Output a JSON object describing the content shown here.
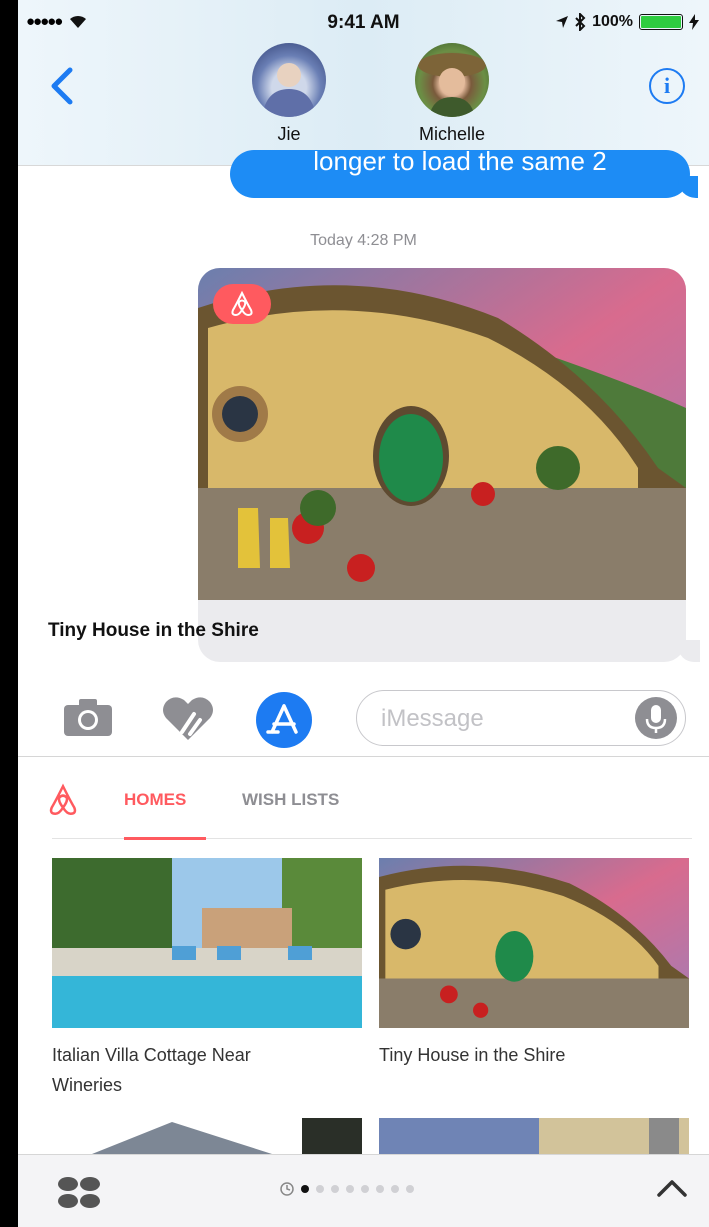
{
  "status_bar": {
    "signal": "●●●●●",
    "time": "9:41 AM",
    "battery_pct": "100%"
  },
  "header": {
    "contacts": [
      {
        "name": "Jie"
      },
      {
        "name": "Michelle"
      }
    ],
    "info_glyph": "i"
  },
  "conversation": {
    "previous_message_fragment": "longer to load the same 2",
    "timestamp": "Today 4:28 PM",
    "shared_card": {
      "title": "Tiny House in the Shire",
      "badge_icon": "airbnb-logo-icon"
    }
  },
  "composer": {
    "placeholder": "iMessage"
  },
  "airbnb_app": {
    "tabs": [
      {
        "label": "HOMES",
        "active": true
      },
      {
        "label": "WISH LISTS",
        "active": false
      }
    ],
    "listings": [
      {
        "title": "Italian Villa Cottage Near Wineries"
      },
      {
        "title": "Tiny House in the Shire"
      }
    ]
  },
  "app_drawer": {
    "page_count": 8,
    "active_page": 1
  },
  "colors": {
    "imessage_blue": "#1d8cf5",
    "airbnb_red": "#ff5a5f",
    "ios_tint": "#1d7bf2"
  }
}
